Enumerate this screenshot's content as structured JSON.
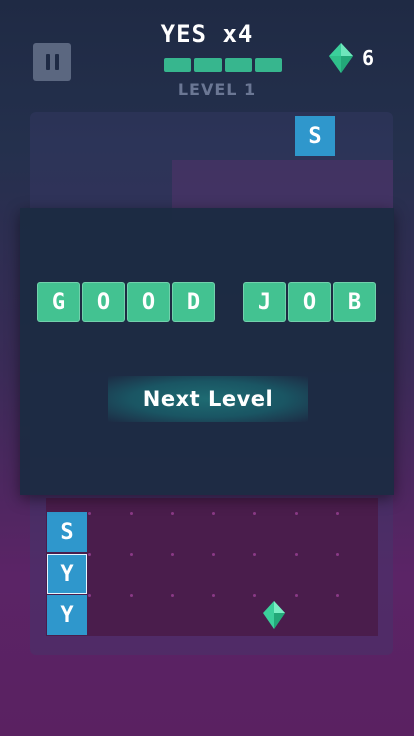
{
  "header": {
    "title": "YES x4",
    "level_label": "LEVEL 1",
    "gem_count": "6",
    "progress_segments": 4
  },
  "board": {
    "falling_tile": "S",
    "stack_tiles": [
      "S",
      "Y",
      "Y"
    ]
  },
  "overlay": {
    "word1": [
      "G",
      "O",
      "O",
      "D"
    ],
    "word2": [
      "J",
      "O",
      "B"
    ],
    "next_button": "Next Level"
  },
  "colors": {
    "tile_blue": "#2f97cc",
    "word_green": "#43c291",
    "gem_green": "#3bcf9b"
  }
}
